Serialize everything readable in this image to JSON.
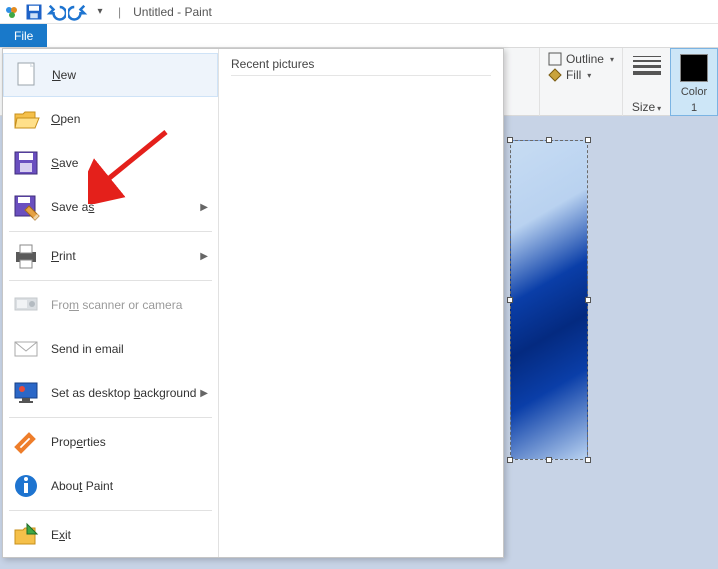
{
  "title": "Untitled - Paint",
  "tabs": {
    "file": "File"
  },
  "ribbon": {
    "outline": "Outline",
    "fill": "Fill",
    "size": "Size",
    "color1_a": "Color",
    "color1_b": "1"
  },
  "fileMenu": {
    "recent": "Recent pictures",
    "items": {
      "new": "ew",
      "new_u": "N",
      "open": "pen",
      "open_u": "O",
      "save": "ave",
      "save_u": "S",
      "saveas_pre": "Save a",
      "saveas_u": "s",
      "print": "rint",
      "print_u": "P",
      "scanner_pre": "Fro",
      "scanner_u": "m",
      "scanner_post": " scanner or camera",
      "email": "Send in email",
      "bg_pre": "Set as desktop ",
      "bg_u": "b",
      "bg_post": "ackground",
      "props_pre": "Prop",
      "props_u": "e",
      "props_post": "rties",
      "about_pre": "Abou",
      "about_u": "t",
      "about_post": " Paint",
      "exit_pre": "E",
      "exit_u": "x",
      "exit_post": "it"
    }
  }
}
